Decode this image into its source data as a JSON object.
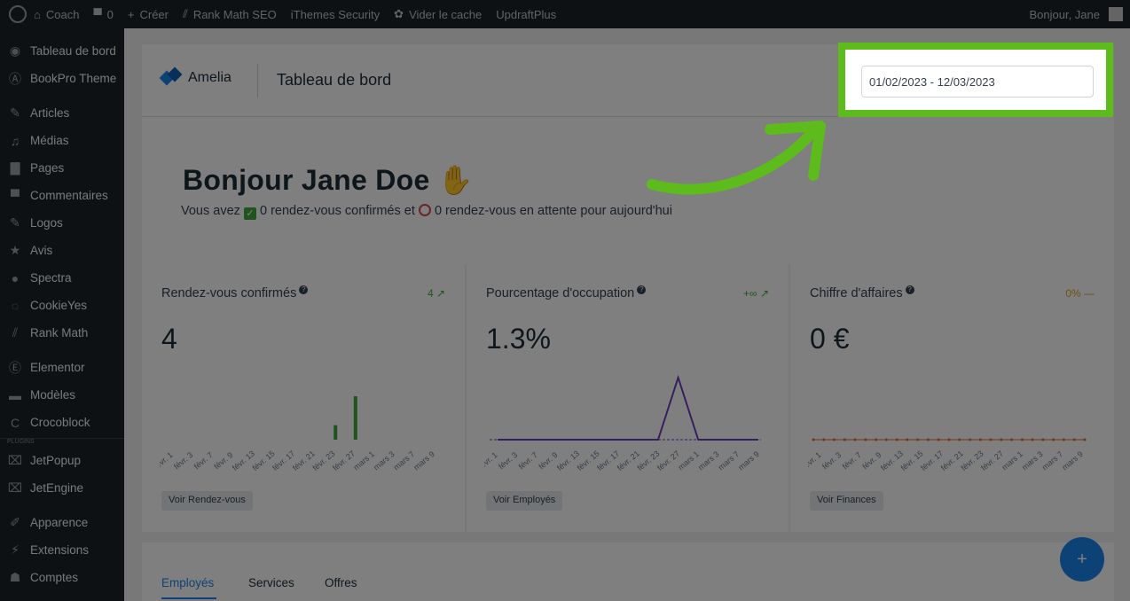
{
  "adminbar": {
    "site": "Coach",
    "comments": "0",
    "new": "Créer",
    "rankmath": "Rank Math SEO",
    "ithemes": "iThemes Security",
    "cache": "Vider le cache",
    "updraft": "UpdraftPlus",
    "greeting": "Bonjour, Jane"
  },
  "sidebar": {
    "items": [
      {
        "label": "Tableau de bord",
        "icon": "dashboard-icon"
      },
      {
        "label": "BookPro Theme",
        "icon": "theme-icon"
      },
      {
        "label": "Articles",
        "icon": "pin-icon"
      },
      {
        "label": "Médias",
        "icon": "media-icon"
      },
      {
        "label": "Pages",
        "icon": "pages-icon"
      },
      {
        "label": "Commentaires",
        "icon": "comment-icon"
      },
      {
        "label": "Logos",
        "icon": "pin-icon"
      },
      {
        "label": "Avis",
        "icon": "star-icon"
      },
      {
        "label": "Spectra",
        "icon": "spectra-icon"
      },
      {
        "label": "CookieYes",
        "icon": "cookie-icon"
      },
      {
        "label": "Rank Math",
        "icon": "rankmath-icon"
      },
      {
        "label": "Elementor",
        "icon": "elementor-icon"
      },
      {
        "label": "Modèles",
        "icon": "folder-icon"
      },
      {
        "label": "Crocoblock",
        "icon": "crocoblock-icon"
      },
      {
        "label": "JetPopup",
        "icon": "jet-icon"
      },
      {
        "label": "JetEngine",
        "icon": "jet-icon"
      },
      {
        "label": "Apparence",
        "icon": "brush-icon"
      },
      {
        "label": "Extensions",
        "icon": "plugin-icon"
      },
      {
        "label": "Comptes",
        "icon": "users-icon"
      }
    ],
    "plugins_label": "PLUGINS"
  },
  "header": {
    "brand": "Amelia",
    "title": "Tableau de bord",
    "date_range": "01/02/2023 - 12/03/2023"
  },
  "greeting": {
    "title": "Bonjour Jane Doe",
    "text_1": "Vous avez",
    "text_2": "0 rendez-vous confirmés et",
    "text_3": "0 rendez-vous en attente pour aujourd'hui"
  },
  "stats": [
    {
      "label": "Rendez-vous confirmés",
      "trend": "4 ↗",
      "value": "4",
      "button": "Voir Rendez-vous",
      "trend_color": "#3fa83a"
    },
    {
      "label": "Pourcentage d'occupation",
      "trend": "+∞ ↗",
      "value": "1.3%",
      "button": "Voir Employés",
      "trend_color": "#3fa83a"
    },
    {
      "label": "Chiffre d'affaires",
      "trend": "0% —",
      "value": "0 €",
      "button": "Voir Finances",
      "trend_color": "#e3a21a"
    }
  ],
  "chart_data": [
    {
      "type": "bar",
      "categories": [
        "févr. 1",
        "févr. 3",
        "févr. 7",
        "févr. 9",
        "févr. 13",
        "févr. 15",
        "févr. 17",
        "févr. 21",
        "févr. 23",
        "févr. 27",
        "mars 1",
        "mars 3",
        "mars 7",
        "mars 9"
      ],
      "values": [
        0,
        0,
        0,
        0,
        0,
        0,
        0,
        0,
        1,
        3,
        0,
        0,
        0,
        0
      ]
    },
    {
      "type": "line",
      "categories": [
        "févr. 1",
        "févr. 3",
        "févr. 7",
        "févr. 9",
        "févr. 13",
        "févr. 15",
        "févr. 17",
        "févr. 21",
        "févr. 23",
        "févr. 27",
        "mars 1",
        "mars 3",
        "mars 7",
        "mars 9"
      ],
      "values": [
        0,
        0,
        0,
        0,
        0,
        0,
        0,
        0,
        0,
        1,
        0,
        0,
        0,
        0
      ]
    },
    {
      "type": "line",
      "categories": [
        "févr. 1",
        "févr. 3",
        "févr. 7",
        "févr. 9",
        "févr. 13",
        "févr. 15",
        "févr. 17",
        "févr. 21",
        "févr. 23",
        "févr. 27",
        "mars 1",
        "mars 3",
        "mars 7",
        "mars 9"
      ],
      "values": [
        0,
        0,
        0,
        0,
        0,
        0,
        0,
        0,
        0,
        0,
        0,
        0,
        0,
        0
      ]
    }
  ],
  "tabs": [
    "Employés",
    "Services",
    "Offres"
  ],
  "fab": "+",
  "colors": {
    "highlight": "#5dbb1c",
    "accent": "#1a84ee"
  }
}
